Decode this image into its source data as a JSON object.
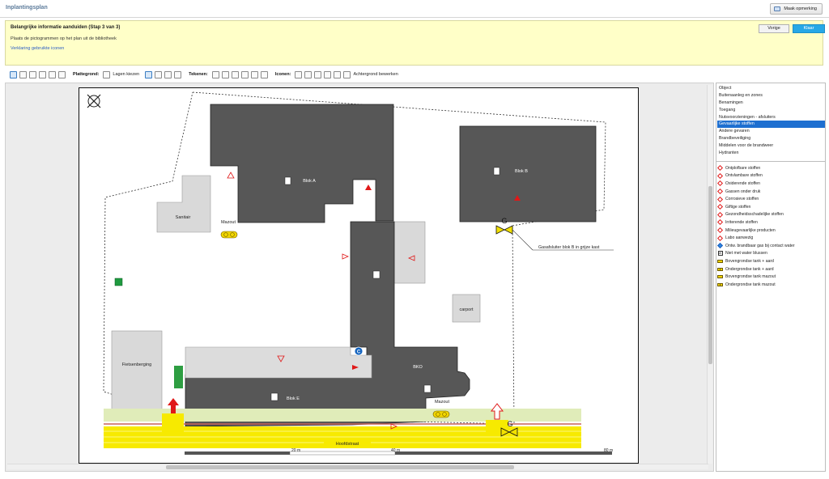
{
  "window": {
    "title": "Inplantingsplan",
    "remark_button": "Maak opmerking"
  },
  "info": {
    "heading": "Belangrijke informatie aanduiden (Stap 3 van 3)",
    "description": "Plaats de pictogrammen op het plan uit de bibliotheek",
    "link": "Verklaring gebruikte iconen",
    "back_button": "Vorige",
    "done_button": "Klaar"
  },
  "toolbar": {
    "plattegrond_label": "Plattegrond:",
    "layers_button": "Lagen kiezen",
    "tekenen_label": "Tekenen:",
    "iconen_label": "Iconen:",
    "background_button": "Achtergrond bewerken"
  },
  "plan": {
    "labels": {
      "blok_a": "Blok A",
      "blok_b": "Blok B",
      "blok_e": "Blok E",
      "sanitair": "Sanitair",
      "mazout_1": "Mazout",
      "mazout_2": "Mazout",
      "carport": "carport",
      "fietsenberging": "Fietsenberging",
      "bko": "BKO",
      "gas_note": "Gasafsluiter blok B in grijze kast",
      "street": "Hoofdstraat",
      "gas_letter_1": "G",
      "gas_letter_2": "G",
      "c_marker": "C"
    },
    "scale": {
      "mark_1": "20 m",
      "mark_2": "40 m",
      "mark_3": "80 m"
    }
  },
  "categories": [
    {
      "label": "Object",
      "active": false
    },
    {
      "label": "Buitenaanleg en zones",
      "active": false
    },
    {
      "label": "Benamingen",
      "active": false
    },
    {
      "label": "Toegang",
      "active": false
    },
    {
      "label": "Nutsvoorzieningen - afsluiters",
      "active": false
    },
    {
      "label": "Gevaarlijke stoffen",
      "active": true
    },
    {
      "label": "Andere gevaren",
      "active": false
    },
    {
      "label": "Brandbeveiliging",
      "active": false
    },
    {
      "label": "Middelen voor de brandweer",
      "active": false
    },
    {
      "label": "Hydranten",
      "active": false
    }
  ],
  "legend": [
    {
      "label": "Ontplofbare stoffen",
      "icon": "explosive-icon"
    },
    {
      "label": "Ontvlambare stoffen",
      "icon": "flammable-icon"
    },
    {
      "label": "Oxiderende stoffen",
      "icon": "oxidizing-icon"
    },
    {
      "label": "Gassen onder druk",
      "icon": "gas-cylinder-icon"
    },
    {
      "label": "Corrosieve stoffen",
      "icon": "corrosive-icon"
    },
    {
      "label": "Giftige stoffen",
      "icon": "toxic-icon"
    },
    {
      "label": "Gezondheidsschadelijke stoffen",
      "icon": "health-hazard-icon"
    },
    {
      "label": "Irriterende stoffen",
      "icon": "irritant-icon"
    },
    {
      "label": "Milieugevaarlijke producten",
      "icon": "environment-icon"
    },
    {
      "label": "Labo aanwezig",
      "icon": "lab-icon"
    },
    {
      "label": "Ontw. brandbaar gas bij contact water",
      "icon": "water-reactive-icon"
    },
    {
      "label": "Niet met water blussen",
      "icon": "no-water-icon"
    },
    {
      "label": "Bovengrondse tank + aard",
      "icon": "tank-above-ground-icon"
    },
    {
      "label": "Ondergrondse tank + aard",
      "icon": "tank-underground-icon"
    },
    {
      "label": "Bovengrondse tank mazout",
      "icon": "tank-above-oil-icon"
    },
    {
      "label": "Ondergrondse tank mazout",
      "icon": "tank-underground-oil-icon"
    }
  ]
}
